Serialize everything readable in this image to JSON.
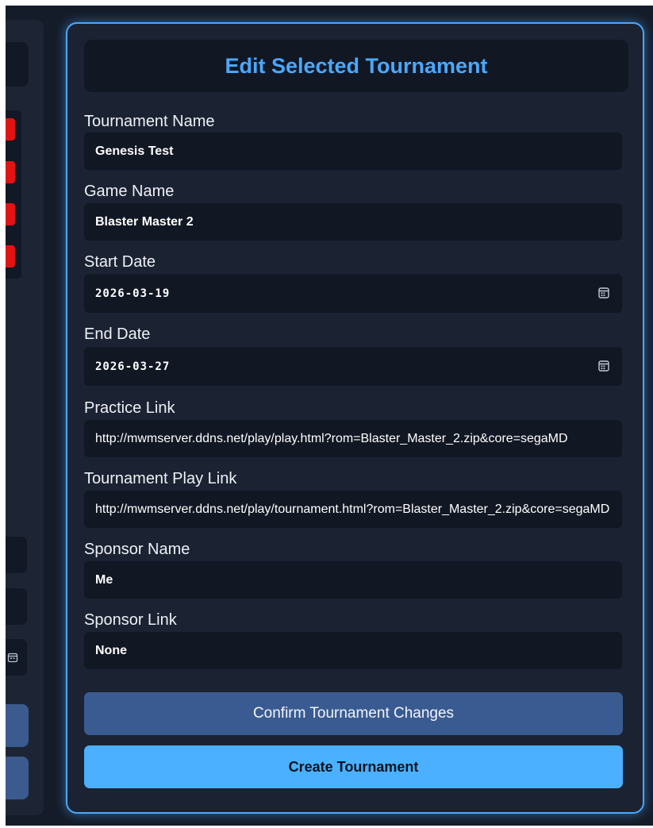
{
  "title": "Edit Selected Tournament",
  "fields": {
    "tournament_name": {
      "label": "Tournament Name",
      "value": "Genesis Test"
    },
    "game_name": {
      "label": "Game Name",
      "value": "Blaster Master 2"
    },
    "start_date": {
      "label": "Start Date",
      "value": "2026-03-19"
    },
    "end_date": {
      "label": "End Date",
      "value": "2026-03-27"
    },
    "practice_link": {
      "label": "Practice Link",
      "value": "http://mwmserver.ddns.net/play/play.html?rom=Blaster_Master_2.zip&core=segaMD"
    },
    "tournament_play_link": {
      "label": "Tournament Play Link",
      "value": "http://mwmserver.ddns.net/play/tournament.html?rom=Blaster_Master_2.zip&core=segaMD"
    },
    "sponsor_name": {
      "label": "Sponsor Name",
      "value": "Me"
    },
    "sponsor_link": {
      "label": "Sponsor Link",
      "value": "None"
    }
  },
  "buttons": {
    "confirm": "Confirm Tournament Changes",
    "create": "Create Tournament"
  },
  "colors": {
    "accent": "#4aa8ff",
    "confirm_bg": "#3a5b91",
    "create_bg": "#4ab0ff",
    "delete_red": "#e01414"
  },
  "icons": {
    "date_picker": "calendar-icon"
  }
}
